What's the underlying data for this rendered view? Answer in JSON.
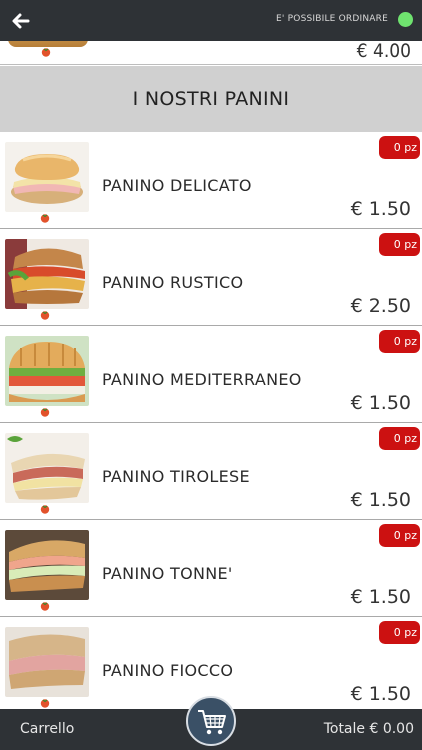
{
  "header": {
    "order_status": "E' POSSIBILE ORDINARE",
    "status_color": "#6fe36f",
    "back_icon": "arrow-left-icon"
  },
  "previous_item": {
    "price": "€ 4.00"
  },
  "section": {
    "title": "I NOSTRI PANINI"
  },
  "products": [
    {
      "name": "PANINO DELICATO",
      "price": "€ 1.50",
      "qty": "0 pz"
    },
    {
      "name": "PANINO RUSTICO",
      "price": "€ 2.50",
      "qty": "0 pz"
    },
    {
      "name": "PANINO MEDITERRANEO",
      "price": "€ 1.50",
      "qty": "0 pz"
    },
    {
      "name": "PANINO TIROLESE",
      "price": "€ 1.50",
      "qty": "0 pz"
    },
    {
      "name": "PANINO TONNE'",
      "price": "€ 1.50",
      "qty": "0 pz"
    },
    {
      "name": "PANINO FIOCCO",
      "price": "€ 1.50",
      "qty": "0 pz"
    }
  ],
  "footer": {
    "cart_label": "Carrello",
    "total": "Totale € 0.00",
    "cart_icon": "shopping-cart-icon"
  },
  "colors": {
    "bar": "#2e3236",
    "badge": "#cc1111",
    "section_bg": "#d0d0d0"
  }
}
